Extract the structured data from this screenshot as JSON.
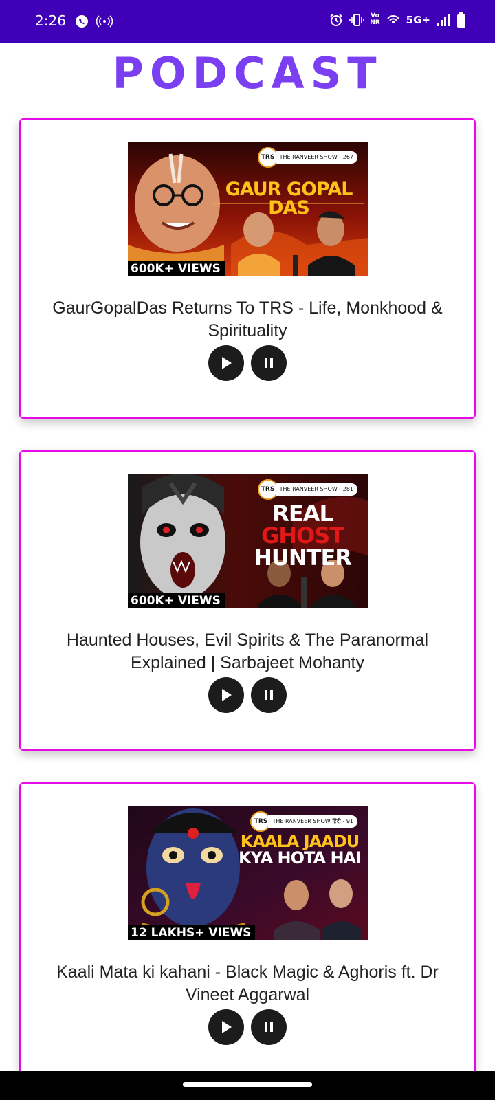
{
  "status_bar": {
    "time": "2:26",
    "network": "5G+",
    "vo_top": "Vo",
    "vo_bottom": "NR",
    "icons": [
      "whatsapp-call-icon",
      "hotspot-icon",
      "alarm-icon",
      "vibrate-icon",
      "volte-icon",
      "wifi-calling-icon",
      "signal-icon",
      "battery-icon"
    ]
  },
  "header": {
    "title": "PODCAST"
  },
  "colors": {
    "accent": "#7b3ff2",
    "status_bar": "#3f00b8",
    "card_border": "#e60be6",
    "button": "#1c1c1c"
  },
  "podcasts": [
    {
      "title": "GaurGopalDas Returns To TRS - Life, Monkhood & Spirituality",
      "thumbnail": {
        "logo": "TRS",
        "show": "THE RANVEER SHOW - 267",
        "headline": [
          "GAUR GOPAL DAS"
        ],
        "views": "600K+ VIEWS"
      }
    },
    {
      "title": "Haunted Houses, Evil Spirits & The Paranormal Explained | Sarbajeet Mohanty",
      "thumbnail": {
        "logo": "TRS",
        "show": "THE RANVEER SHOW - 281",
        "headline": [
          "REAL",
          "GHOST",
          "HUNTER"
        ],
        "views": "600K+ VIEWS"
      }
    },
    {
      "title": "Kaali Mata ki kahani - Black Magic & Aghoris ft. Dr Vineet Aggarwal",
      "thumbnail": {
        "logo": "TRS",
        "show": "THE RANVEER SHOW हिंदी - 91",
        "headline": [
          "KAALA JAADU",
          "KYA HOTA HAI"
        ],
        "views": "12 LAKHS+ VIEWS"
      }
    }
  ]
}
